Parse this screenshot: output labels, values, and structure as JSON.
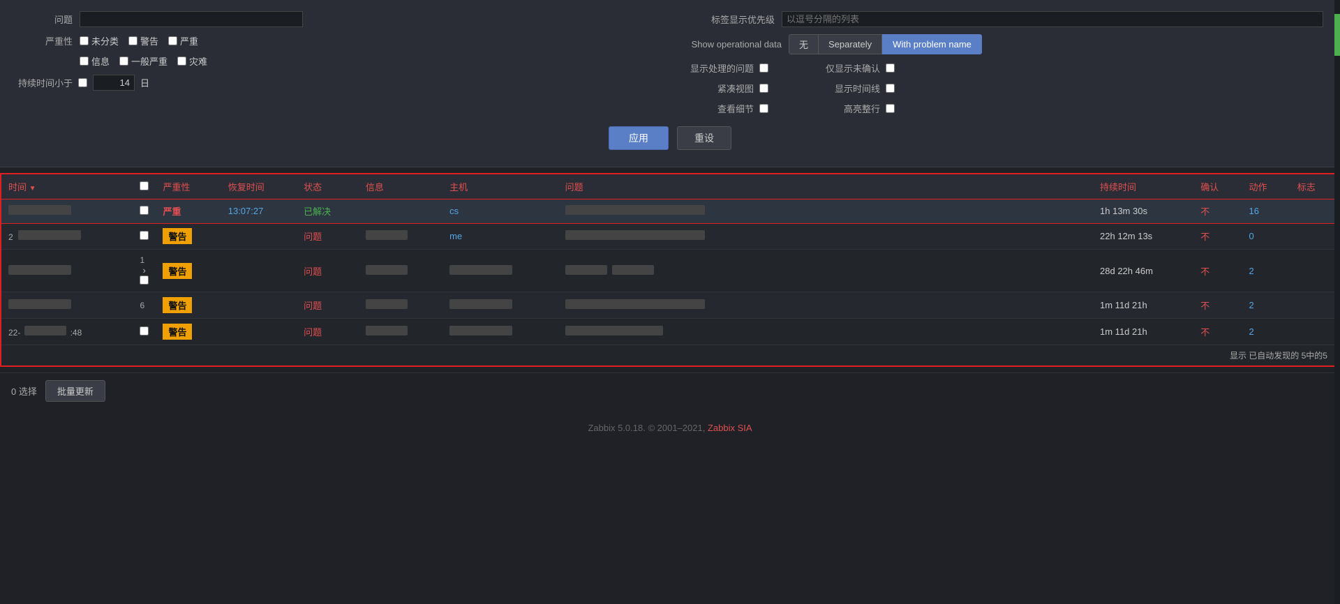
{
  "filter": {
    "problem_label": "问题",
    "severity_label": "严重性",
    "severity_options": [
      "未分类",
      "警告",
      "严重",
      "信息",
      "一般严重",
      "灾难"
    ],
    "duration_label": "持续时间小于",
    "duration_value": "14",
    "duration_unit": "日",
    "tag_priority_label": "标签显示优先级",
    "tag_priority_placeholder": "以逗号分隔的列表",
    "op_data_label": "Show operational data",
    "op_data_options": [
      "无",
      "Separately",
      "With problem name"
    ],
    "op_data_active": "With problem name",
    "show_resolved_label": "显示处理的问题",
    "unconfirmed_label": "仅显示未确认",
    "compact_label": "紧凑视图",
    "show_timeline_label": "显示时间线",
    "view_details_label": "查看细节",
    "highlight_label": "高亮整行",
    "apply_label": "应用",
    "reset_label": "重设"
  },
  "table": {
    "columns": {
      "time": "时间",
      "severity": "严重性",
      "recovery_time": "恢复时间",
      "status": "状态",
      "info": "信息",
      "host": "主机",
      "problem": "问题",
      "duration": "持续时间",
      "ack": "确认",
      "action": "动作",
      "tags": "标志"
    },
    "rows": [
      {
        "id": "row1",
        "time": "",
        "severity": "严重",
        "severity_type": "critical",
        "recovery_time": "13:07:27",
        "status": "已解决",
        "status_type": "resolved",
        "info": "",
        "host": "cs",
        "host_type": "text",
        "problem": "",
        "duration": "1h 13m 30s",
        "ack": "不",
        "action": "16",
        "tags": "",
        "selected": true,
        "row_number": ""
      },
      {
        "id": "row2",
        "time": "",
        "severity": "警告",
        "severity_type": "warning",
        "recovery_time": "",
        "status": "问题",
        "status_type": "problem",
        "info": "",
        "host": "me",
        "host_type": "text",
        "problem": "",
        "duration": "22h 12m 13s",
        "ack": "不",
        "action": "0",
        "tags": "",
        "selected": false,
        "row_number": "2"
      },
      {
        "id": "row3",
        "time": "",
        "severity": "警告",
        "severity_type": "warning",
        "recovery_time": "",
        "status": "问题",
        "status_type": "problem",
        "info": "",
        "host": "",
        "host_type": "blurred",
        "problem": "",
        "duration": "28d 22h 46m",
        "ack": "不",
        "action": "2",
        "tags": "",
        "selected": false,
        "row_number": "1"
      },
      {
        "id": "row4",
        "time": "",
        "severity": "警告",
        "severity_type": "warning",
        "recovery_time": "",
        "status": "问题",
        "status_type": "problem",
        "info": "",
        "host": "",
        "host_type": "blurred",
        "problem": "",
        "duration": "1m 11d 21h",
        "ack": "不",
        "action": "2",
        "tags": "",
        "selected": false,
        "row_number": "6"
      },
      {
        "id": "row5",
        "time": "",
        "severity": "警告",
        "severity_type": "warning",
        "recovery_time": "",
        "status": "问题",
        "status_type": "problem",
        "info": "",
        "host": "",
        "host_type": "blurred",
        "problem": "",
        "duration": "1m 11d 21h",
        "ack": "不",
        "action": "2",
        "tags": "",
        "selected": false,
        "row_number": "22-:48"
      }
    ],
    "footer": "显示 已自动发现的 5中的5"
  },
  "bottom": {
    "select_count": "0 选择",
    "batch_label": "批量更新"
  },
  "footer": {
    "copyright": "Zabbix 5.0.18. © 2001–2021,",
    "company": "Zabbix SIA"
  }
}
